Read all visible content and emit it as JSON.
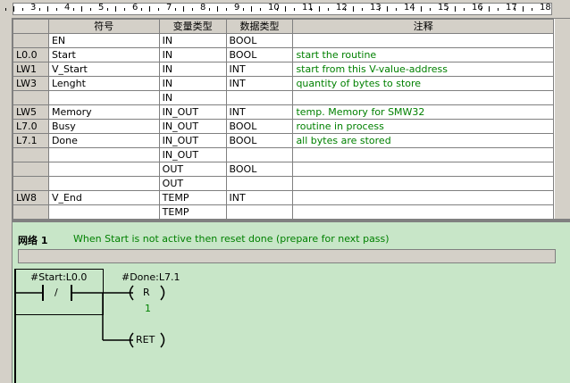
{
  "ruler": {
    "numbers": [
      "3",
      "4",
      "5",
      "6",
      "7",
      "8",
      "9",
      "10",
      "11",
      "12",
      "13",
      "14",
      "15",
      "16",
      "17",
      "18"
    ]
  },
  "table": {
    "headers": [
      "",
      "符号",
      "变量类型",
      "数据类型",
      "注释"
    ],
    "rows": [
      {
        "addr": "",
        "symbol": "EN",
        "vartype": "IN",
        "datatype": "BOOL",
        "comment": ""
      },
      {
        "addr": "L0.0",
        "symbol": "Start",
        "vartype": "IN",
        "datatype": "BOOL",
        "comment": "start the routine"
      },
      {
        "addr": "LW1",
        "symbol": "V_Start",
        "vartype": "IN",
        "datatype": "INT",
        "comment": "start from this V-value-address"
      },
      {
        "addr": "LW3",
        "symbol": "Lenght",
        "vartype": "IN",
        "datatype": "INT",
        "comment": "quantity of bytes to store"
      },
      {
        "addr": "",
        "symbol": "",
        "vartype": "IN",
        "datatype": "",
        "comment": ""
      },
      {
        "addr": "LW5",
        "symbol": "Memory",
        "vartype": "IN_OUT",
        "datatype": "INT",
        "comment": "temp. Memory for SMW32"
      },
      {
        "addr": "L7.0",
        "symbol": "Busy",
        "vartype": "IN_OUT",
        "datatype": "BOOL",
        "comment": "routine in process"
      },
      {
        "addr": "L7.1",
        "symbol": "Done",
        "vartype": "IN_OUT",
        "datatype": "BOOL",
        "comment": "all bytes are stored"
      },
      {
        "addr": "",
        "symbol": "",
        "vartype": "IN_OUT",
        "datatype": "",
        "comment": ""
      },
      {
        "addr": "",
        "symbol": "",
        "vartype": "OUT",
        "datatype": "BOOL",
        "comment": ""
      },
      {
        "addr": "",
        "symbol": "",
        "vartype": "OUT",
        "datatype": "",
        "comment": ""
      },
      {
        "addr": "LW8",
        "symbol": "V_End",
        "vartype": "TEMP",
        "datatype": "INT",
        "comment": ""
      },
      {
        "addr": "",
        "symbol": "",
        "vartype": "TEMP",
        "datatype": "",
        "comment": ""
      }
    ]
  },
  "network": {
    "title": "网络 1",
    "comment": "When Start is not active then reset done (prepare for next pass)",
    "contact_label": "#Start:L0.0",
    "contact_symbol": "/",
    "coil_label": "#Done:L7.1",
    "coil_symbol": "R",
    "coil_value": "1",
    "ret_symbol": "RET"
  },
  "colors": {
    "comment_green": "#008000",
    "ladder_bg": "#c8e6c8",
    "gray": "#d4d0c8"
  }
}
